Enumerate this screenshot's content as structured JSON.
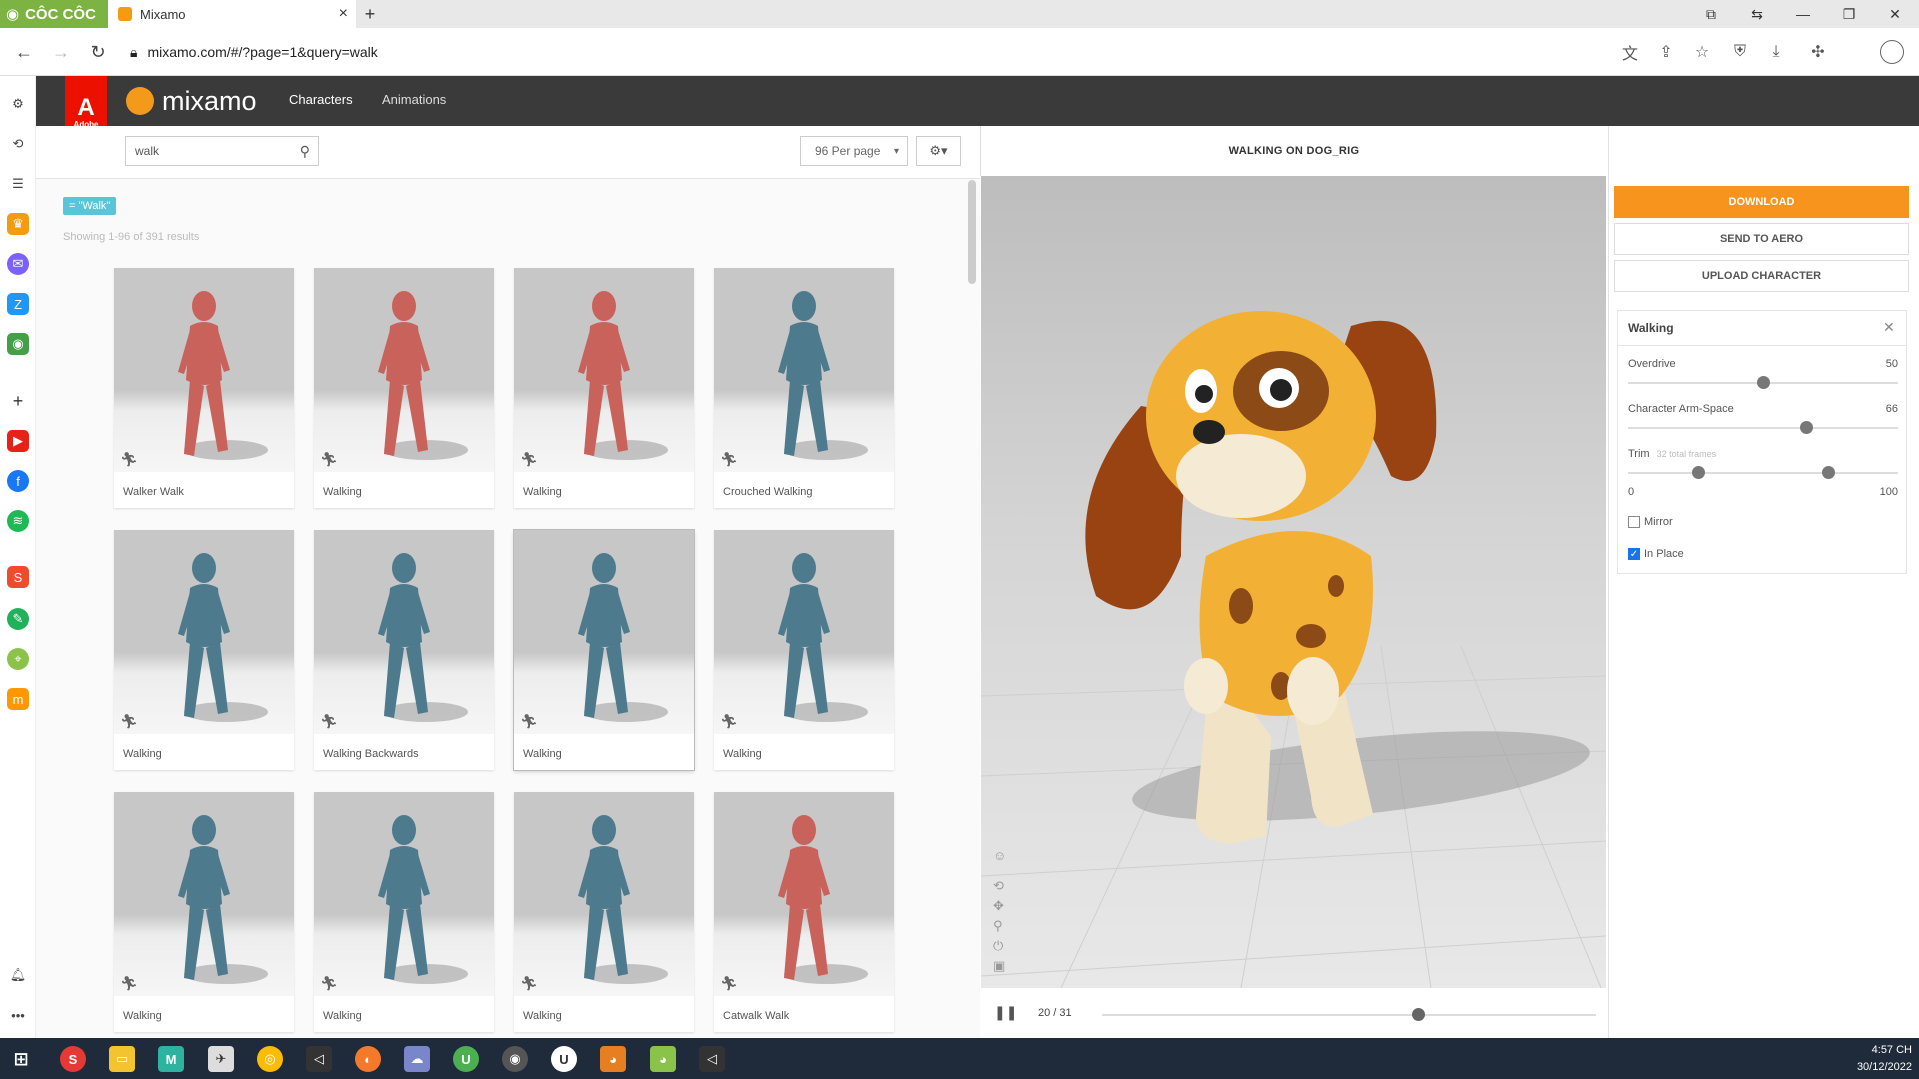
{
  "browser": {
    "brand": "CÔC CÔC",
    "tab_title": "Mixamo",
    "url": "mixamo.com/#/?page=1&query=walk",
    "new_tab": "+",
    "close_tab": "×"
  },
  "header": {
    "adobe_label": "Adobe",
    "logo_text": "mixamo",
    "nav": [
      "Characters",
      "Animations"
    ]
  },
  "search": {
    "query": "walk",
    "per_page": "96 Per page",
    "tag": "= \"Walk\"",
    "showing": "Showing 1-96 of 391 results"
  },
  "results": [
    {
      "label": "Walker Walk",
      "model": "red"
    },
    {
      "label": "Walking",
      "model": "red"
    },
    {
      "label": "Walking",
      "model": "red"
    },
    {
      "label": "Crouched Walking",
      "model": "blue"
    },
    {
      "label": "Walking",
      "model": "blue"
    },
    {
      "label": "Walking Backwards",
      "model": "blue"
    },
    {
      "label": "Walking",
      "model": "blue"
    },
    {
      "label": "Walking",
      "model": "blue"
    },
    {
      "label": "Walking",
      "model": "blue"
    },
    {
      "label": "Walking",
      "model": "blue"
    },
    {
      "label": "Walking",
      "model": "blue"
    },
    {
      "label": "Catwalk Walk",
      "model": "red"
    }
  ],
  "viewer": {
    "title": "WALKING ON DOG_RIG",
    "frame": "20 / 31",
    "progress": 0.64
  },
  "actions": {
    "download": "DOWNLOAD",
    "send": "SEND TO AERO",
    "upload": "UPLOAD CHARACTER"
  },
  "settings": {
    "title": "Walking",
    "overdrive_label": "Overdrive",
    "overdrive_value": "50",
    "armspace_label": "Character Arm-Space",
    "armspace_value": "66",
    "trim_label": "Trim",
    "trim_sub": "32 total frames",
    "trim_min": "0",
    "trim_max": "100",
    "trim_start": 0.26,
    "trim_end": 0.74,
    "mirror_label": "Mirror",
    "mirror_checked": false,
    "inplace_label": "In Place",
    "inplace_checked": true
  },
  "clock": {
    "time": "4:57 CH",
    "date": "30/12/2022"
  },
  "colors": {
    "accent_orange": "#f7941d",
    "adobe_red": "#eb1000",
    "tag_blue": "#59c5d9",
    "header_dark": "#3a3a3a",
    "red_model": "#c8625a",
    "blue_model": "#4d7a8c"
  }
}
